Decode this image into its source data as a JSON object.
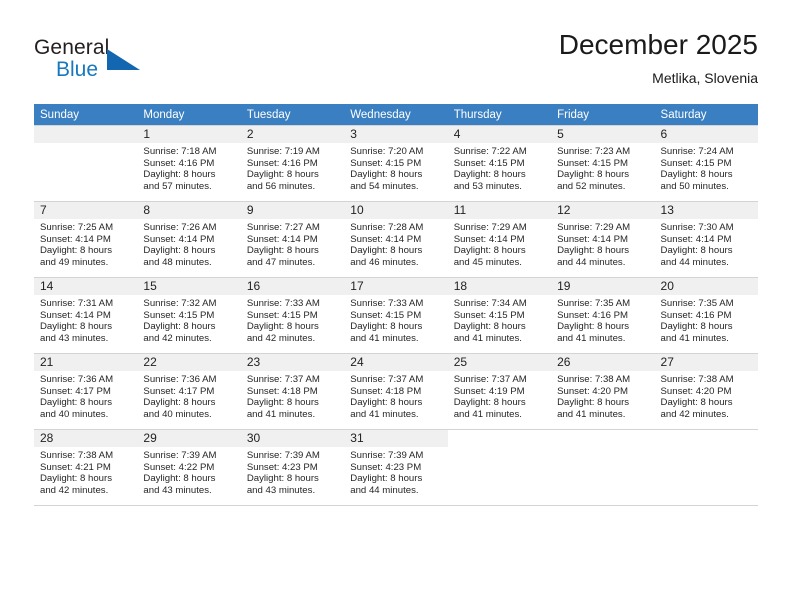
{
  "brand": {
    "name_part1": "General",
    "name_part2": "Blue",
    "logo_icon": "triangle-logo-icon"
  },
  "header": {
    "title": "December 2025",
    "location": "Metlika, Slovenia"
  },
  "calendar": {
    "weekday_headers": [
      "Sunday",
      "Monday",
      "Tuesday",
      "Wednesday",
      "Thursday",
      "Friday",
      "Saturday"
    ],
    "accent_color": "#3a7fc1",
    "daynum_band_color": "#f0f0f0",
    "weeks": [
      [
        {
          "day": "",
          "sunrise": "",
          "sunset": "",
          "daylight_line1": "",
          "daylight_line2": ""
        },
        {
          "day": "1",
          "sunrise": "Sunrise: 7:18 AM",
          "sunset": "Sunset: 4:16 PM",
          "daylight_line1": "Daylight: 8 hours",
          "daylight_line2": "and 57 minutes."
        },
        {
          "day": "2",
          "sunrise": "Sunrise: 7:19 AM",
          "sunset": "Sunset: 4:16 PM",
          "daylight_line1": "Daylight: 8 hours",
          "daylight_line2": "and 56 minutes."
        },
        {
          "day": "3",
          "sunrise": "Sunrise: 7:20 AM",
          "sunset": "Sunset: 4:15 PM",
          "daylight_line1": "Daylight: 8 hours",
          "daylight_line2": "and 54 minutes."
        },
        {
          "day": "4",
          "sunrise": "Sunrise: 7:22 AM",
          "sunset": "Sunset: 4:15 PM",
          "daylight_line1": "Daylight: 8 hours",
          "daylight_line2": "and 53 minutes."
        },
        {
          "day": "5",
          "sunrise": "Sunrise: 7:23 AM",
          "sunset": "Sunset: 4:15 PM",
          "daylight_line1": "Daylight: 8 hours",
          "daylight_line2": "and 52 minutes."
        },
        {
          "day": "6",
          "sunrise": "Sunrise: 7:24 AM",
          "sunset": "Sunset: 4:15 PM",
          "daylight_line1": "Daylight: 8 hours",
          "daylight_line2": "and 50 minutes."
        }
      ],
      [
        {
          "day": "7",
          "sunrise": "Sunrise: 7:25 AM",
          "sunset": "Sunset: 4:14 PM",
          "daylight_line1": "Daylight: 8 hours",
          "daylight_line2": "and 49 minutes."
        },
        {
          "day": "8",
          "sunrise": "Sunrise: 7:26 AM",
          "sunset": "Sunset: 4:14 PM",
          "daylight_line1": "Daylight: 8 hours",
          "daylight_line2": "and 48 minutes."
        },
        {
          "day": "9",
          "sunrise": "Sunrise: 7:27 AM",
          "sunset": "Sunset: 4:14 PM",
          "daylight_line1": "Daylight: 8 hours",
          "daylight_line2": "and 47 minutes."
        },
        {
          "day": "10",
          "sunrise": "Sunrise: 7:28 AM",
          "sunset": "Sunset: 4:14 PM",
          "daylight_line1": "Daylight: 8 hours",
          "daylight_line2": "and 46 minutes."
        },
        {
          "day": "11",
          "sunrise": "Sunrise: 7:29 AM",
          "sunset": "Sunset: 4:14 PM",
          "daylight_line1": "Daylight: 8 hours",
          "daylight_line2": "and 45 minutes."
        },
        {
          "day": "12",
          "sunrise": "Sunrise: 7:29 AM",
          "sunset": "Sunset: 4:14 PM",
          "daylight_line1": "Daylight: 8 hours",
          "daylight_line2": "and 44 minutes."
        },
        {
          "day": "13",
          "sunrise": "Sunrise: 7:30 AM",
          "sunset": "Sunset: 4:14 PM",
          "daylight_line1": "Daylight: 8 hours",
          "daylight_line2": "and 44 minutes."
        }
      ],
      [
        {
          "day": "14",
          "sunrise": "Sunrise: 7:31 AM",
          "sunset": "Sunset: 4:14 PM",
          "daylight_line1": "Daylight: 8 hours",
          "daylight_line2": "and 43 minutes."
        },
        {
          "day": "15",
          "sunrise": "Sunrise: 7:32 AM",
          "sunset": "Sunset: 4:15 PM",
          "daylight_line1": "Daylight: 8 hours",
          "daylight_line2": "and 42 minutes."
        },
        {
          "day": "16",
          "sunrise": "Sunrise: 7:33 AM",
          "sunset": "Sunset: 4:15 PM",
          "daylight_line1": "Daylight: 8 hours",
          "daylight_line2": "and 42 minutes."
        },
        {
          "day": "17",
          "sunrise": "Sunrise: 7:33 AM",
          "sunset": "Sunset: 4:15 PM",
          "daylight_line1": "Daylight: 8 hours",
          "daylight_line2": "and 41 minutes."
        },
        {
          "day": "18",
          "sunrise": "Sunrise: 7:34 AM",
          "sunset": "Sunset: 4:15 PM",
          "daylight_line1": "Daylight: 8 hours",
          "daylight_line2": "and 41 minutes."
        },
        {
          "day": "19",
          "sunrise": "Sunrise: 7:35 AM",
          "sunset": "Sunset: 4:16 PM",
          "daylight_line1": "Daylight: 8 hours",
          "daylight_line2": "and 41 minutes."
        },
        {
          "day": "20",
          "sunrise": "Sunrise: 7:35 AM",
          "sunset": "Sunset: 4:16 PM",
          "daylight_line1": "Daylight: 8 hours",
          "daylight_line2": "and 41 minutes."
        }
      ],
      [
        {
          "day": "21",
          "sunrise": "Sunrise: 7:36 AM",
          "sunset": "Sunset: 4:17 PM",
          "daylight_line1": "Daylight: 8 hours",
          "daylight_line2": "and 40 minutes."
        },
        {
          "day": "22",
          "sunrise": "Sunrise: 7:36 AM",
          "sunset": "Sunset: 4:17 PM",
          "daylight_line1": "Daylight: 8 hours",
          "daylight_line2": "and 40 minutes."
        },
        {
          "day": "23",
          "sunrise": "Sunrise: 7:37 AM",
          "sunset": "Sunset: 4:18 PM",
          "daylight_line1": "Daylight: 8 hours",
          "daylight_line2": "and 41 minutes."
        },
        {
          "day": "24",
          "sunrise": "Sunrise: 7:37 AM",
          "sunset": "Sunset: 4:18 PM",
          "daylight_line1": "Daylight: 8 hours",
          "daylight_line2": "and 41 minutes."
        },
        {
          "day": "25",
          "sunrise": "Sunrise: 7:37 AM",
          "sunset": "Sunset: 4:19 PM",
          "daylight_line1": "Daylight: 8 hours",
          "daylight_line2": "and 41 minutes."
        },
        {
          "day": "26",
          "sunrise": "Sunrise: 7:38 AM",
          "sunset": "Sunset: 4:20 PM",
          "daylight_line1": "Daylight: 8 hours",
          "daylight_line2": "and 41 minutes."
        },
        {
          "day": "27",
          "sunrise": "Sunrise: 7:38 AM",
          "sunset": "Sunset: 4:20 PM",
          "daylight_line1": "Daylight: 8 hours",
          "daylight_line2": "and 42 minutes."
        }
      ],
      [
        {
          "day": "28",
          "sunrise": "Sunrise: 7:38 AM",
          "sunset": "Sunset: 4:21 PM",
          "daylight_line1": "Daylight: 8 hours",
          "daylight_line2": "and 42 minutes."
        },
        {
          "day": "29",
          "sunrise": "Sunrise: 7:39 AM",
          "sunset": "Sunset: 4:22 PM",
          "daylight_line1": "Daylight: 8 hours",
          "daylight_line2": "and 43 minutes."
        },
        {
          "day": "30",
          "sunrise": "Sunrise: 7:39 AM",
          "sunset": "Sunset: 4:23 PM",
          "daylight_line1": "Daylight: 8 hours",
          "daylight_line2": "and 43 minutes."
        },
        {
          "day": "31",
          "sunrise": "Sunrise: 7:39 AM",
          "sunset": "Sunset: 4:23 PM",
          "daylight_line1": "Daylight: 8 hours",
          "daylight_line2": "and 44 minutes."
        },
        {
          "day": "",
          "sunrise": "",
          "sunset": "",
          "daylight_line1": "",
          "daylight_line2": ""
        },
        {
          "day": "",
          "sunrise": "",
          "sunset": "",
          "daylight_line1": "",
          "daylight_line2": ""
        },
        {
          "day": "",
          "sunrise": "",
          "sunset": "",
          "daylight_line1": "",
          "daylight_line2": ""
        }
      ]
    ]
  }
}
